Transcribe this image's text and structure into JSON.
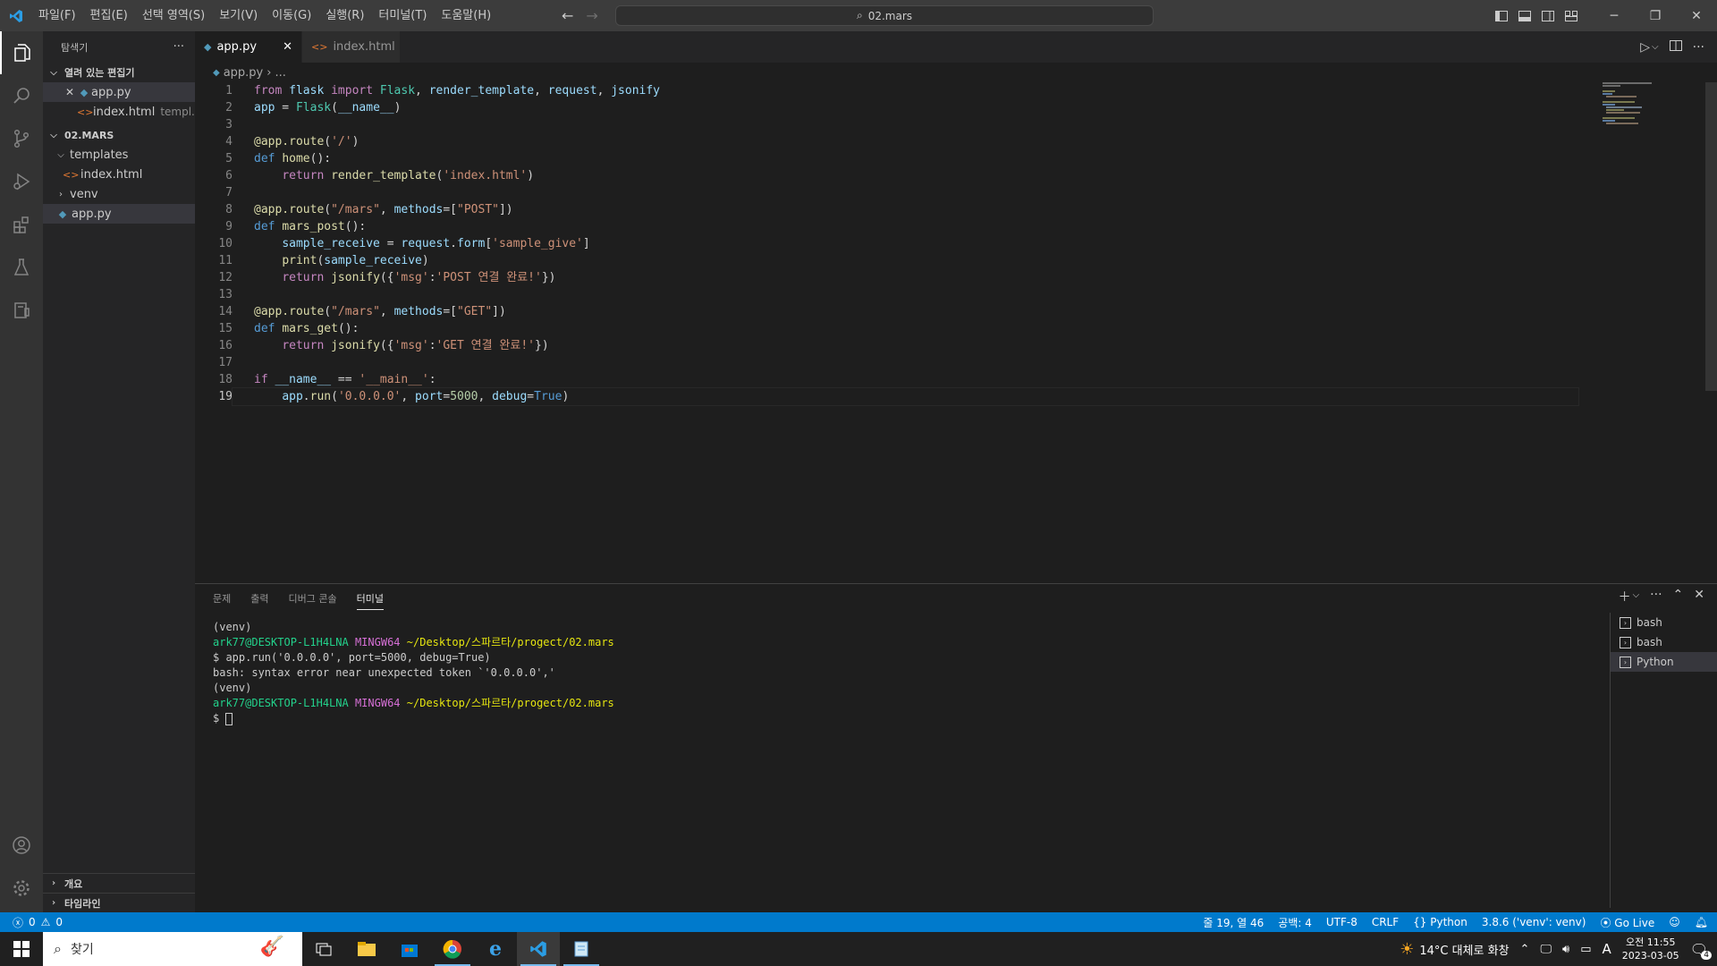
{
  "titlebar": {
    "menu": [
      "파일(F)",
      "편집(E)",
      "선택 영역(S)",
      "보기(V)",
      "이동(G)",
      "실행(R)",
      "터미널(T)",
      "도움말(H)"
    ],
    "search_text": "02.mars"
  },
  "sidebar": {
    "title": "탐색기",
    "more": "···",
    "open_editors_label": "열려 있는 편집기",
    "open_editors": [
      {
        "name": "app.py",
        "desc": ""
      },
      {
        "name": "index.html",
        "desc": "templ..."
      }
    ],
    "folder_label": "02.MARS",
    "tree": {
      "templates": "templates",
      "index_html": "index.html",
      "venv": "venv",
      "app_py": "app.py"
    },
    "outline_label": "개요",
    "timeline_label": "타임라인"
  },
  "tabs": [
    {
      "label": "app.py",
      "active": true
    },
    {
      "label": "index.html",
      "active": false
    }
  ],
  "breadcrumb": {
    "file": "app.py",
    "rest": "..."
  },
  "code_lines": [
    "from flask import Flask, render_template, request, jsonify",
    "app = Flask(__name__)",
    "",
    "@app.route('/')",
    "def home():",
    "    return render_template('index.html')",
    "",
    "@app.route(\"/mars\", methods=[\"POST\"])",
    "def mars_post():",
    "    sample_receive = request.form['sample_give']",
    "    print(sample_receive)",
    "    return jsonify({'msg':'POST 연결 완료!'})",
    "",
    "@app.route(\"/mars\", methods=[\"GET\"])",
    "def mars_get():",
    "    return jsonify({'msg':'GET 연결 완료!'})",
    "",
    "if __name__ == '__main__':",
    "    app.run('0.0.0.0', port=5000, debug=True)"
  ],
  "current_line": 19,
  "panel": {
    "tabs": [
      "문제",
      "출력",
      "디버그 콘솔",
      "터미널"
    ],
    "active_tab": "터미널",
    "terminal": {
      "venv": "(venv)",
      "user_host": "ark77@DESKTOP-L1H4LNA",
      "shell": "MINGW64",
      "path": "~/Desktop/스파르타/progect/02.mars",
      "cmd1": "$ app.run('0.0.0.0', port=5000, debug=True)",
      "error": "bash: syntax error near unexpected token `'0.0.0.0','",
      "prompt": "$ "
    },
    "terminal_list": [
      "bash",
      "bash",
      "Python"
    ]
  },
  "statusbar": {
    "errors": "0",
    "warnings": "0",
    "position": "줄 19, 열 46",
    "spaces": "공백: 4",
    "encoding": "UTF-8",
    "eol": "CRLF",
    "language": "Python",
    "interpreter": "3.8.6 ('venv': venv)",
    "golive": "Go Live"
  },
  "taskbar": {
    "search_placeholder": "찾기",
    "weather": "14°C  대체로 화창",
    "time": "오전 11:55",
    "date": "2023-03-05",
    "notifications": "4",
    "ime": "A"
  },
  "colors": {
    "accent": "#007acc",
    "background": "#1e1e1e",
    "sidebar": "#252526",
    "activitybar": "#333333"
  }
}
